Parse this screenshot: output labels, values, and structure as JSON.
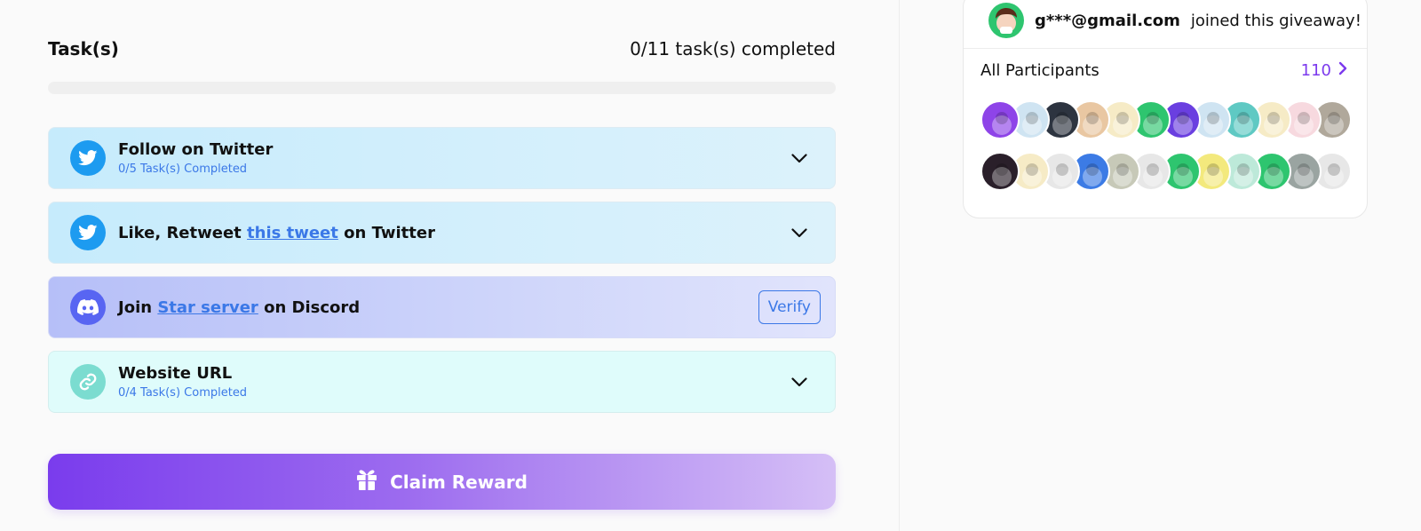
{
  "tasks": {
    "title": "Task(s)",
    "progress_text": "0/11 task(s) completed",
    "progress_fraction": 0,
    "items": [
      {
        "icon": "twitter-icon",
        "title": "Follow on Twitter",
        "subtitle": "0/5 Task(s) Completed",
        "action": "expand"
      },
      {
        "icon": "twitter-icon",
        "title_prefix": "Like, Retweet ",
        "title_link": "this tweet",
        "title_suffix": " on Twitter",
        "action": "expand"
      },
      {
        "icon": "discord-icon",
        "title_prefix": "Join ",
        "title_link": "Star server",
        "title_suffix": " on Discord",
        "action": "verify",
        "verify_label": "Verify"
      },
      {
        "icon": "link-icon",
        "title": "Website URL",
        "subtitle": "0/4 Task(s) Completed",
        "action": "expand"
      }
    ],
    "claim_label": "Claim Reward"
  },
  "activity": {
    "email": "g***@gmail.com",
    "text": "joined this giveaway!"
  },
  "participants": {
    "title": "All Participants",
    "count": "110",
    "row1": [
      "#8e44e8",
      "#cfe4f2",
      "#2d3440",
      "#e9c7a2",
      "#f6ebc6",
      "#2ec56f",
      "#6a3fe0",
      "#cfe4f2",
      "#5fc9c3",
      "#f6ebc6",
      "#f7d9df",
      "#b0a89b"
    ],
    "row2": [
      "#2a1f2a",
      "#f6ebc6",
      "#e7e7e7",
      "#3c7be5",
      "#c7c9b8",
      "#e7e7e7",
      "#2ec56f",
      "#f3e97d",
      "#bde9d9",
      "#2ec56f",
      "#9aa4a1",
      "#e7e7e7"
    ]
  },
  "colors": {
    "accent": "#7c3aed",
    "link": "#3b78e7",
    "twitter": "#1d9bf0",
    "discord": "#5865f2"
  }
}
